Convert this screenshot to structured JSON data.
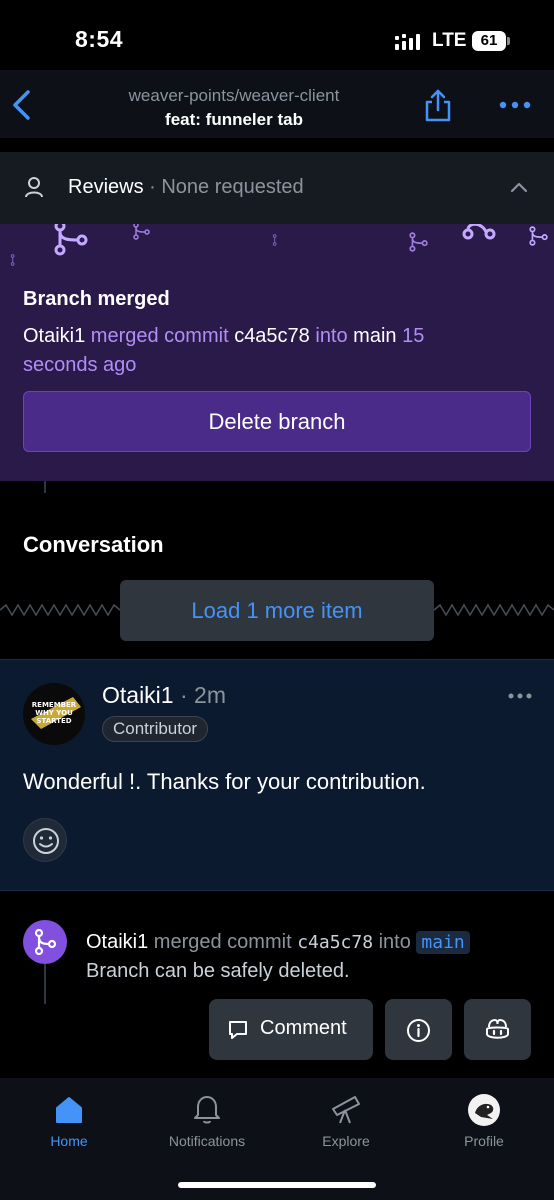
{
  "status_bar": {
    "time": "8:54",
    "network": "LTE",
    "battery": "61"
  },
  "header": {
    "repo": "weaver-points/weaver-client",
    "title": "feat: funneler tab",
    "icons": [
      "chevron-left-icon",
      "share-icon",
      "ellipsis-icon"
    ]
  },
  "reviews": {
    "label": "Reviews",
    "status": "· None requested"
  },
  "merge_banner": {
    "title": "Branch merged",
    "user": "Otaiki1",
    "merged_commit_text": " merged commit ",
    "commit": "c4a5c78",
    "into_text": " into ",
    "branch": "main",
    "time": " 15 seconds ago",
    "delete_label": "Delete branch"
  },
  "conversation": {
    "heading": "Conversation",
    "load_more": "Load 1 more item"
  },
  "comment": {
    "author": "Otaiki1",
    "time": " · 2m",
    "badge": "Contributor",
    "body": "Wonderful !. Thanks for your contribution.",
    "avatar_text": [
      "REMEMBER",
      "WHY YOU",
      "STARTED"
    ]
  },
  "merge_event": {
    "user": "Otaiki1",
    "merged_commit_text": " merged commit ",
    "commit": "c4a5c78",
    "into_text": " into ",
    "branch": "main",
    "note": "Branch can be safely deleted."
  },
  "actions": {
    "comment_label": "Comment"
  },
  "tabs": [
    {
      "label": "Home",
      "icon": "home-icon",
      "active": true
    },
    {
      "label": "Notifications",
      "icon": "bell-icon"
    },
    {
      "label": "Explore",
      "icon": "telescope-icon"
    },
    {
      "label": "Profile",
      "icon": "avatar"
    }
  ],
  "colors": {
    "accent": "#4493f8",
    "merged": "#8250df",
    "banner_bg": "#2a1a4a"
  }
}
